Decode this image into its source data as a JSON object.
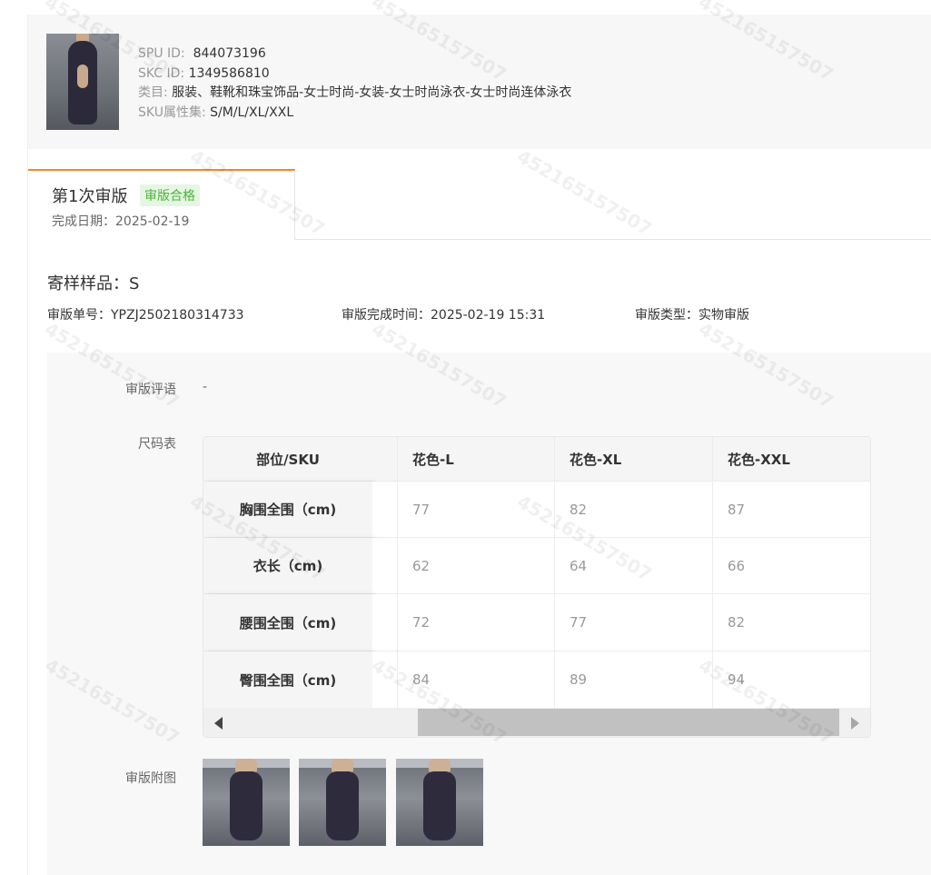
{
  "product": {
    "spu_label": "SPU ID:",
    "spu_value": "844073196",
    "skc_label": "SKC ID:",
    "skc_value": "1349586810",
    "category_label": "类目:",
    "category_value": "服装、鞋靴和珠宝饰品-女士时尚-女装-女士时尚泳衣-女士时尚连体泳衣",
    "sku_label": "SKU属性集:",
    "sku_value": "S/M/L/XL/XXL"
  },
  "tab": {
    "title": "第1次审版",
    "badge": "审版合格",
    "badge_color": "#4bb43a",
    "date": "完成日期：2025-02-19"
  },
  "sample": {
    "title": "寄样样品：S",
    "order_no": "审版单号：YPZJ2502180314733",
    "finish_time": "审版完成时间：2025-02-19 15:31",
    "type": "审版类型：实物审版"
  },
  "detail": {
    "comment_label": "审版评语",
    "comment_value": "-",
    "size_table_label": "尺码表",
    "attachments_label": "审版附图"
  },
  "size_table": {
    "first_header": "部位/SKU",
    "columns": [
      "花色-L",
      "花色-XL",
      "花色-XXL"
    ],
    "rows": [
      {
        "part": "胸围全围（cm)",
        "values": [
          "77",
          "82",
          "87"
        ]
      },
      {
        "part": "衣长（cm)",
        "values": [
          "62",
          "64",
          "66"
        ]
      },
      {
        "part": "腰围全围（cm)",
        "values": [
          "72",
          "77",
          "82"
        ]
      },
      {
        "part": "臀围全围（cm)",
        "values": [
          "84",
          "89",
          "94"
        ]
      }
    ]
  },
  "watermark": "452165157507",
  "accent_color": "#f08a24"
}
